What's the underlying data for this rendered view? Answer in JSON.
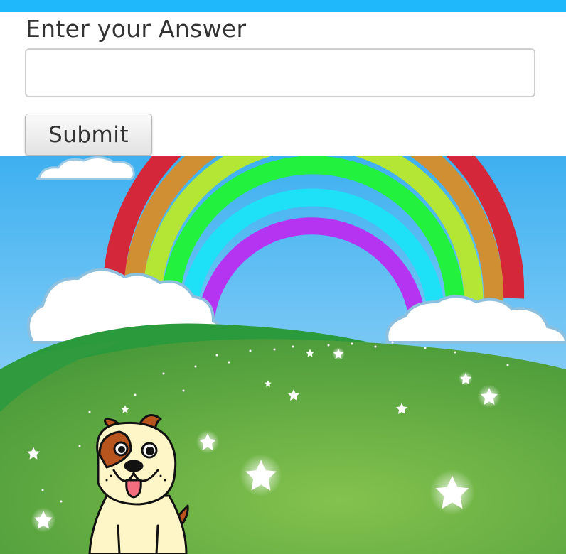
{
  "form": {
    "prompt_label": "Enter your Answer",
    "answer_value": "",
    "submit_label": "Submit"
  },
  "colors": {
    "top_bar": "#1fb8fb",
    "sky_top": "#3eb0f0",
    "sky_bottom": "#b9e2fa",
    "hill_back": "#2a9a3c",
    "hill_front": "#6cb848",
    "rainbow": [
      "#d4283a",
      "#d18f34",
      "#b4e635",
      "#22f23e",
      "#1ee0f7",
      "#b534f2"
    ]
  },
  "scene": {
    "icons": [
      "rainbow-icon",
      "cloud-icon",
      "star-icon",
      "dog-icon"
    ]
  }
}
